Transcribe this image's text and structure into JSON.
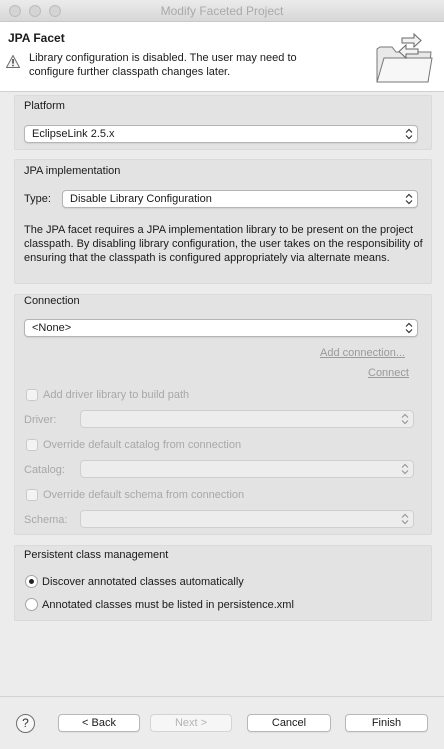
{
  "window": {
    "title": "Modify Faceted Project"
  },
  "header": {
    "title": "JPA Facet",
    "warning": "Library configuration is disabled. The user may need to configure further classpath changes later.",
    "warning_icon": "warning-icon",
    "banner_icon": "folder-arrows-icon"
  },
  "platform": {
    "label": "Platform",
    "value": "EclipseLink 2.5.x"
  },
  "jpa_impl": {
    "label": "JPA implementation",
    "type_label": "Type:",
    "type_value": "Disable Library Configuration",
    "description": "The JPA facet requires a JPA implementation library to be present on the project classpath. By disabling library configuration, the user takes on the responsibility of ensuring that the classpath is configured appropriately via alternate means."
  },
  "connection": {
    "label": "Connection",
    "value": "<None>",
    "add_connection": "Add connection...",
    "connect": "Connect",
    "add_driver_library": "Add driver library to build path",
    "driver_label": "Driver:",
    "override_catalog": "Override default catalog from connection",
    "catalog_label": "Catalog:",
    "override_schema": "Override default schema from connection",
    "schema_label": "Schema:"
  },
  "persistence": {
    "label": "Persistent class management",
    "option_auto": "Discover annotated classes automatically",
    "option_listed": "Annotated classes must be listed in persistence.xml",
    "selected": "Discover annotated classes automatically"
  },
  "buttons": {
    "help": "?",
    "back": "< Back",
    "next": "Next >",
    "cancel": "Cancel",
    "finish": "Finish"
  },
  "colors": {
    "window_bg": "#ececec",
    "panel_bg": "#e3e3e3",
    "header_bg": "#ffffff",
    "disabled_text": "#a8a8a8"
  }
}
